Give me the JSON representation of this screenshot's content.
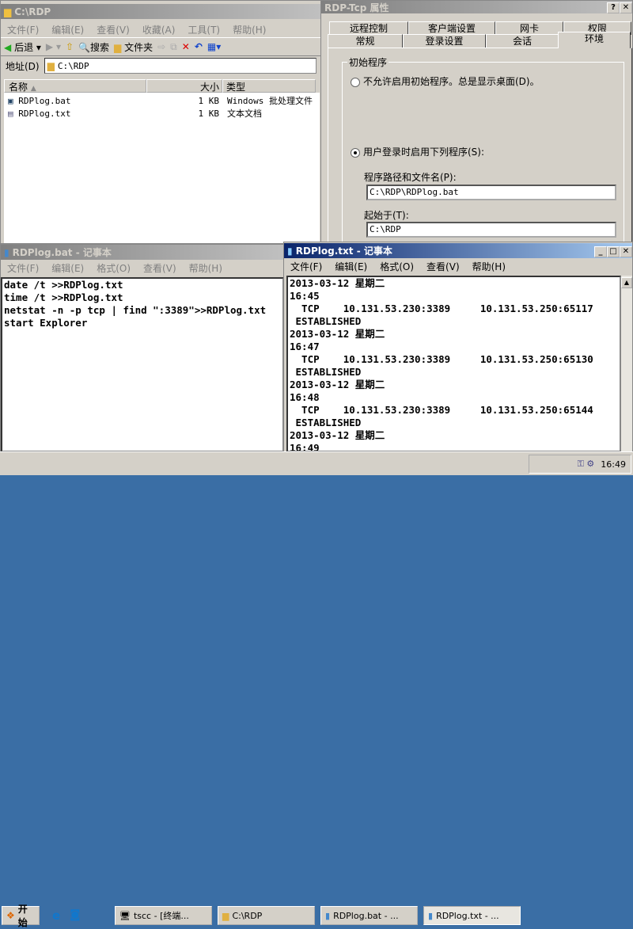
{
  "explorer": {
    "title": "C:\\RDP",
    "menu": [
      "文件(F)",
      "编辑(E)",
      "查看(V)",
      "收藏(A)",
      "工具(T)",
      "帮助(H)"
    ],
    "back": "后退",
    "search": "搜索",
    "folders": "文件夹",
    "address_label": "地址(D)",
    "address": "C:\\RDP",
    "columns": [
      "名称",
      "大小",
      "类型"
    ],
    "files": [
      {
        "name": "RDPlog.bat",
        "size": "1 KB",
        "type": "Windows 批处理文件",
        "icon": "batch-file-icon"
      },
      {
        "name": "RDPlog.txt",
        "size": "1 KB",
        "type": "文本文档",
        "icon": "text-file-icon"
      }
    ]
  },
  "dialog": {
    "title": "RDP-Tcp 属性",
    "tabs_back": [
      "远程控制",
      "客户端设置",
      "网卡",
      "权限"
    ],
    "tabs_front": [
      "常规",
      "登录设置",
      "会话",
      "环境"
    ],
    "group": "初始程序",
    "radio1": "不允许启用初始程序。总是显示桌面(D)。",
    "radio2": "用户登录时启用下列程序(S):",
    "path_label": "程序路径和文件名(P):",
    "path": "C:\\RDP\\RDPlog.bat",
    "start_label": "起始于(T):",
    "start": "C:\\RDP"
  },
  "bat": {
    "title": "RDPlog.bat - 记事本",
    "menu": [
      "文件(F)",
      "编辑(E)",
      "格式(O)",
      "查看(V)",
      "帮助(H)"
    ],
    "content": "date /t >>RDPlog.txt\ntime /t >>RDPlog.txt\nnetstat -n -p tcp | find \":3389\">>RDPlog.txt\nstart Explorer"
  },
  "txt": {
    "title": "RDPlog.txt - 记事本",
    "menu": [
      "文件(F)",
      "编辑(E)",
      "格式(O)",
      "查看(V)",
      "帮助(H)"
    ],
    "content": "2013-03-12 星期二\n16:45\n  TCP    10.131.53.230:3389     10.131.53.250:65117\n ESTABLISHED\n2013-03-12 星期二\n16:47\n  TCP    10.131.53.230:3389     10.131.53.250:65130\n ESTABLISHED\n2013-03-12 星期二\n16:48\n  TCP    10.131.53.230:3389     10.131.53.250:65144\n ESTABLISHED\n2013-03-12 星期二\n16:49"
  },
  "taskbar": {
    "start": "开始",
    "items": [
      "tscc - [终端...",
      "C:\\RDP",
      "RDPlog.bat - ...",
      "RDPlog.txt - ..."
    ],
    "clock": "16:49"
  }
}
